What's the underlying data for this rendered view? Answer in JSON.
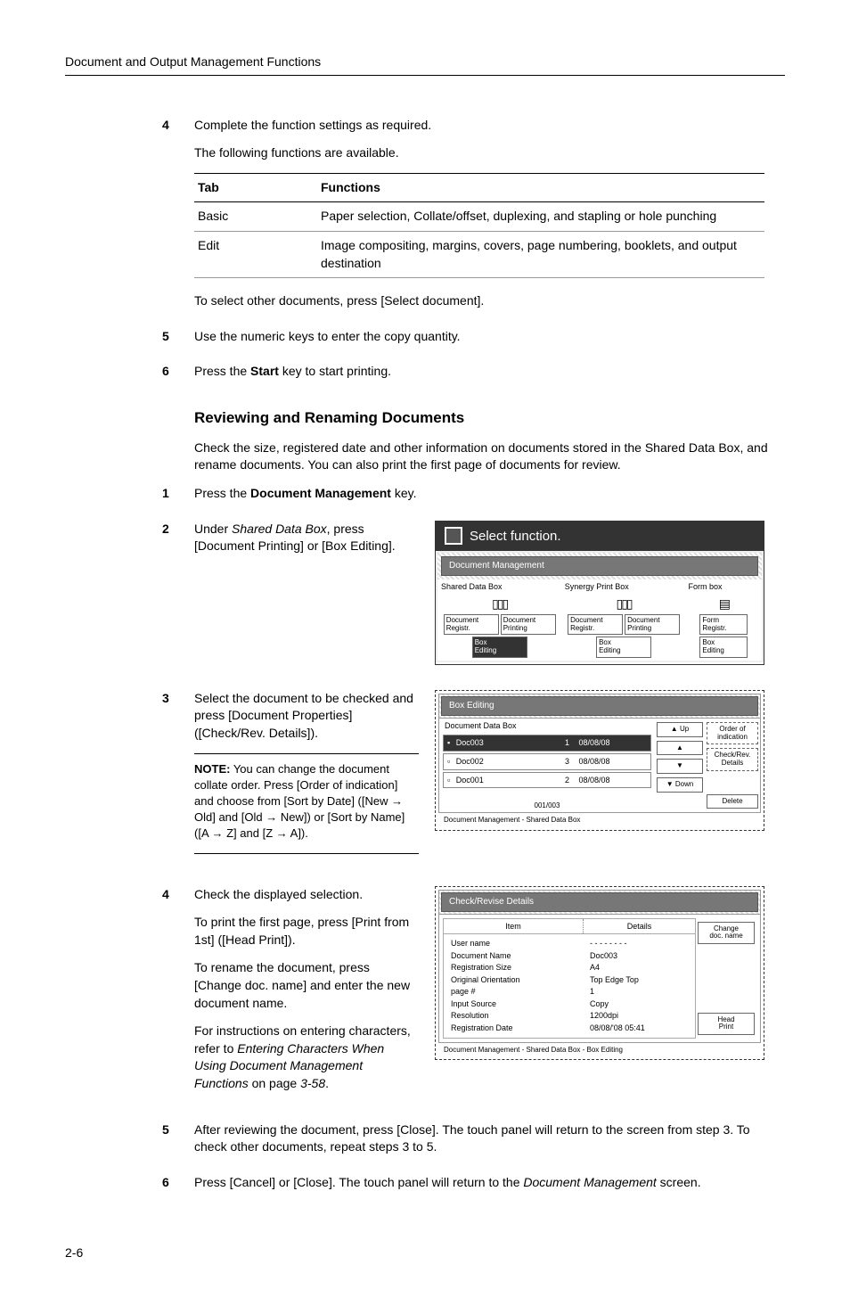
{
  "header": {
    "running": "Document and Output Management Functions"
  },
  "sec1": {
    "s4": {
      "num": "4",
      "l1": "Complete the function settings as required.",
      "l2": "The following functions are available.",
      "th1": "Tab",
      "th2": "Functions",
      "r1c1": "Basic",
      "r1c2": "Paper selection, Collate/offset, duplexing, and stapling or hole punching",
      "r2c1": "Edit",
      "r2c2": "Image compositing, margins, covers, page numbering, booklets, and output destination",
      "after": "To select other documents, press [Select document]."
    },
    "s5": {
      "num": "5",
      "t": "Use the numeric keys to enter the copy quantity."
    },
    "s6": {
      "num": "6",
      "pre": "Press the ",
      "bold": "Start",
      "post": " key to start printing."
    }
  },
  "section_title": "Reviewing and Renaming Documents",
  "intro": "Check the size, registered date and other information on documents stored in the Shared Data Box, and rename documents. You can also print the first page of documents for review.",
  "s1": {
    "num": "1",
    "pre": "Press the ",
    "bold": "Document Management",
    "post": " key."
  },
  "s2": {
    "num": "2",
    "l1a": "Under ",
    "l1i": "Shared Data Box",
    "l1b": ", press [Document Printing] or [Box Editing]."
  },
  "panel1": {
    "title": "Select function.",
    "sub": "Document Management",
    "tabs": [
      "Shared Data Box",
      "Synergy Print Box",
      "Form box"
    ],
    "btns": {
      "a1": "Document\nRegistr.",
      "a2": "Document\nPrinting",
      "b1": "Document\nRegistr.",
      "b2": "Document\nPrinting",
      "c1": "Form\nRegistr.",
      "a3": "Box\nEditing",
      "b3": "Box\nEditing",
      "c3": "Box\nEditing"
    }
  },
  "s3": {
    "num": "3",
    "t": "Select the document to be checked and press [Document Properties] ([Check/Rev. Details]).",
    "note_label": "NOTE:",
    "note": " You can change the document collate order. Press [Order of indication] and choose from [Sort by Date] ([New → Old] and [Old → New]) or [Sort by Name] ([A → Z] and [Z → A])."
  },
  "panel2": {
    "title": "Box Editing",
    "list_head": "Document Data Box",
    "rows": [
      {
        "n": "Doc003",
        "c": "1",
        "d": "08/08/08"
      },
      {
        "n": "Doc002",
        "c": "3",
        "d": "08/08/08"
      },
      {
        "n": "Doc001",
        "c": "2",
        "d": "08/08/08"
      }
    ],
    "counter": "001/003",
    "btn_up": "Up",
    "btn_order": "Order of\nindication",
    "btn_check": "Check/Rev.\nDetails",
    "btn_down": "Down",
    "btn_del": "Delete",
    "crumb": "Document Management   -   Shared Data Box"
  },
  "s4b": {
    "num": "4",
    "l1": "Check the displayed selection.",
    "l2": "To print the first page, press [Print from 1st] ([Head Print]).",
    "l3": "To rename the document, press [Change doc. name] and enter the new document name.",
    "l4a": "For instructions on entering characters, refer to ",
    "l4i": "Entering Characters When Using Document Management Functions",
    "l4b": " on page ",
    "l4p": "3-58",
    "l4c": "."
  },
  "panel3": {
    "title": "Check/Revise Details",
    "h1": "Item",
    "h2": "Details",
    "items": [
      "User name",
      "Document Name",
      "Registration Size",
      "Original Orientation",
      "page #",
      "Input Source",
      "Resolution",
      "Registration Date"
    ],
    "vals": [
      "- - - - - - - -",
      "Doc003",
      "A4",
      "Top Edge Top",
      "1",
      "Copy",
      "1200dpi",
      "08/08/'08 05:41"
    ],
    "btn_change": "Change\ndoc. name",
    "btn_head": "Head\nPrint",
    "crumb": "Document Management   -   Shared Data Box   -   Box Editing"
  },
  "s5b": {
    "num": "5",
    "t": "After reviewing the document, press [Close]. The touch panel will return to the screen from step 3. To check other documents, repeat steps 3 to 5."
  },
  "s6b": {
    "num": "6",
    "a": "Press [Cancel] or [Close]. The touch panel will return to the ",
    "i": "Document Management",
    "b": " screen."
  },
  "page": "2-6"
}
